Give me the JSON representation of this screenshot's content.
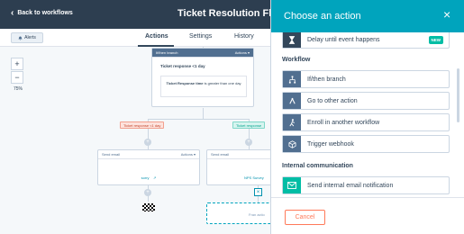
{
  "header": {
    "back_label": "Back to workflows",
    "title": "Ticket Resolution Flow"
  },
  "subbar": {
    "alerts_label": "Alerts",
    "tabs": [
      "Actions",
      "Settings",
      "History"
    ],
    "active_tab": "Actions"
  },
  "canvas": {
    "zoom_in": "+",
    "zoom_out": "−",
    "zoom_level": "75%",
    "branch_node": {
      "header": "If/then branch",
      "actions_label": "Actions ▾",
      "title": "Ticket response <1 day",
      "condition_prefix": "Ticket Response time",
      "condition_suffix": "is greater than one day"
    },
    "branch_tags": {
      "left": "Ticket response <1 day",
      "right": "Ticket response"
    },
    "left_email": {
      "header": "Send email",
      "actions_label": "Actions ▾",
      "link": "sorry"
    },
    "right_email": {
      "header": "Send email",
      "link": "NPS Survey"
    },
    "partial_node_text": "Fran actio"
  },
  "panel": {
    "title": "Choose an action",
    "close_label": "×",
    "top_action": {
      "label": "Delay until event happens",
      "badge": "NEW",
      "icon": "hourglass-icon"
    },
    "sections": [
      {
        "title": "Workflow",
        "actions": [
          {
            "label": "If/then branch",
            "icon": "branch-icon"
          },
          {
            "label": "Go to other action",
            "icon": "go-to-icon"
          },
          {
            "label": "Enroll in another workflow",
            "icon": "person-walk-icon"
          },
          {
            "label": "Trigger webhook",
            "icon": "webhook-cube-icon"
          }
        ]
      },
      {
        "title": "Internal communication",
        "actions": [
          {
            "label": "Send internal email notification",
            "icon": "email-icon"
          }
        ]
      }
    ],
    "cancel_label": "Cancel"
  },
  "colors": {
    "topbar": "#2d3e50",
    "panel_header": "#00a4bd",
    "accent_orange": "#ff7a59",
    "badge_green": "#00bda5",
    "icon_slate": "#516f90"
  }
}
